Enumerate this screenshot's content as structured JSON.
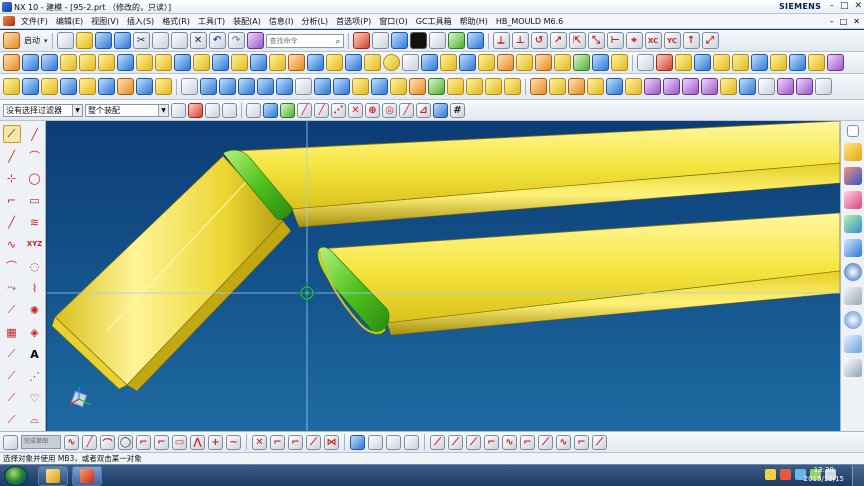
{
  "window": {
    "title": "NX 10 - 建模 - [95-2.prt （修改的，只读）]",
    "brand": "SIEMENS",
    "controls": [
      "–",
      "□",
      "✕"
    ]
  },
  "menu": {
    "items": [
      "文件(F)",
      "编辑(E)",
      "视图(V)",
      "插入(S)",
      "格式(R)",
      "工具(T)",
      "装配(A)",
      "信息(I)",
      "分析(L)",
      "首选项(P)",
      "窗口(O)",
      "GC工具箱",
      "帮助(H)",
      "HB_MOULD M6.6"
    ],
    "right_controls": [
      "–",
      "□",
      "✕"
    ]
  },
  "toolbar1": {
    "start_label": "启动",
    "search_placeholder": "查找命令"
  },
  "selection_bar": {
    "filter_value": "没有选择过滤器",
    "scope_value": "整个装配"
  },
  "bottom_toolbar": {
    "font_box": "完成草图"
  },
  "status": {
    "message": "选择对象并使用 MB3，或者双击某一对象"
  },
  "taskbar": {
    "time": "13:30",
    "date": "2015/12/15"
  },
  "colors": {
    "part_yellow": "#f2e23a",
    "fillet_green": "#5fcf2b",
    "background_top": "#0d3c76",
    "background_bottom": "#1e6aa2",
    "crosshair": "#9fd0e8"
  },
  "icons": {
    "viewport": [
      "crosshair-icon",
      "wcs-triad-icon"
    ],
    "taskbar": [
      "start-orb-icon",
      "explorer-icon",
      "nx-app-icon"
    ]
  }
}
